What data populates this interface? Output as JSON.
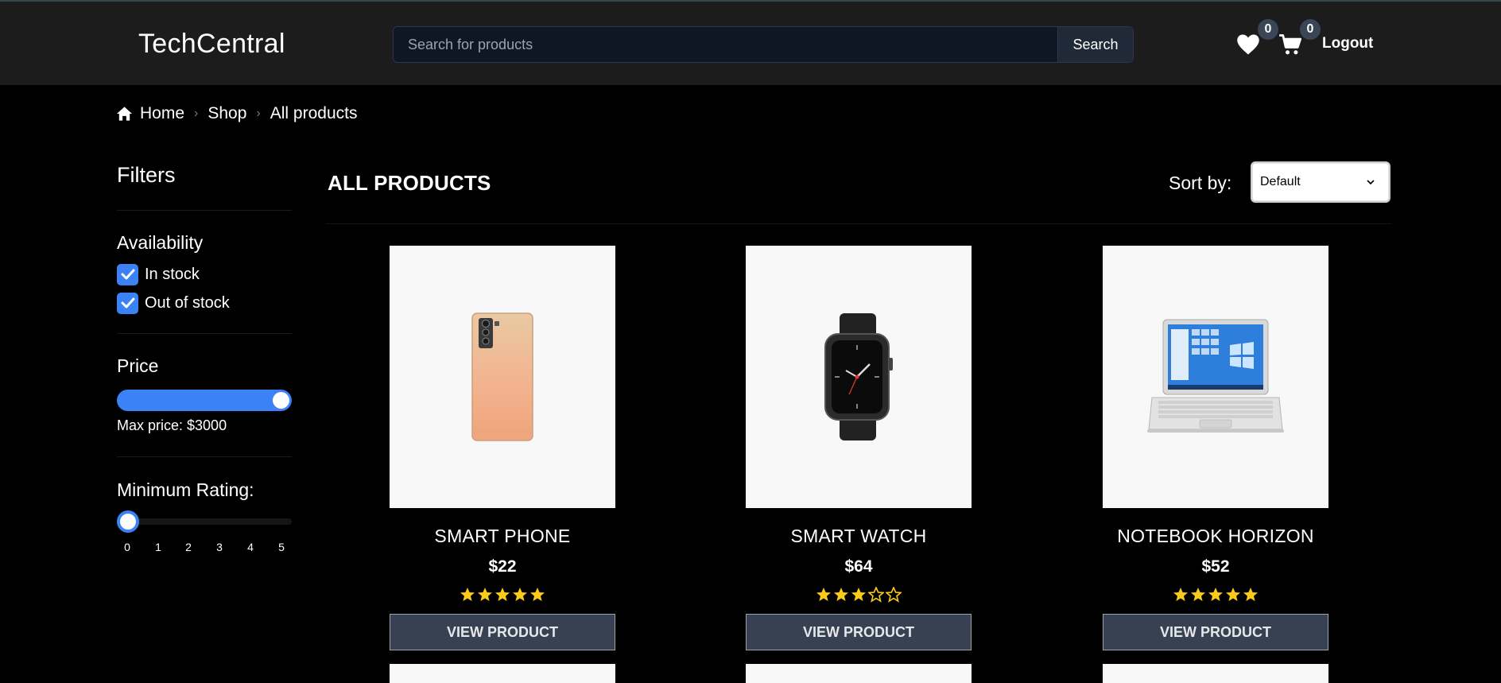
{
  "header": {
    "logo": "TechCentral",
    "search_placeholder": "Search for products",
    "search_button": "Search",
    "wishlist_count": "0",
    "cart_count": "0",
    "logout": "Logout"
  },
  "breadcrumb": [
    "Home",
    "Shop",
    "All products"
  ],
  "filters": {
    "title": "Filters",
    "availability": {
      "title": "Availability",
      "options": [
        {
          "label": "In stock",
          "checked": true
        },
        {
          "label": "Out of stock",
          "checked": true
        }
      ]
    },
    "price": {
      "title": "Price",
      "max_label": "Max price: $3000",
      "slider_fraction": 1.0
    },
    "rating": {
      "title": "Minimum Rating:",
      "value": 0,
      "ticks": [
        "0",
        "1",
        "2",
        "3",
        "4",
        "5"
      ]
    }
  },
  "main": {
    "title": "ALL PRODUCTS",
    "sort_label": "Sort by:",
    "sort_value": "Default"
  },
  "products": [
    {
      "name": "SMART PHONE",
      "price": "$22",
      "rating": 5,
      "button": "VIEW PRODUCT",
      "image_icon": "smartphone-image"
    },
    {
      "name": "SMART WATCH",
      "price": "$64",
      "rating": 3,
      "button": "VIEW PRODUCT",
      "image_icon": "smartwatch-image"
    },
    {
      "name": "NOTEBOOK HORIZON",
      "price": "$52",
      "rating": 5,
      "button": "VIEW PRODUCT",
      "image_icon": "laptop-image"
    }
  ],
  "colors": {
    "accent": "#3b82f6",
    "star": "#facc15",
    "header_bg": "#1c1c1c",
    "button_bg": "#374151"
  }
}
